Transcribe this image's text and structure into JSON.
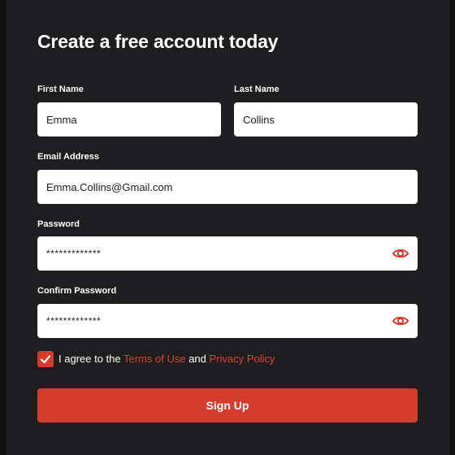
{
  "form": {
    "title": "Create a free account today",
    "first_name": {
      "label": "First Name",
      "value": "Emma"
    },
    "last_name": {
      "label": "Last Name",
      "value": "Collins"
    },
    "email": {
      "label": "Email Address",
      "value": "Emma.Collins@Gmail.com"
    },
    "password": {
      "label": "Password",
      "value": "*************"
    },
    "confirm_password": {
      "label": "Confirm Password",
      "value": "*************"
    },
    "agree": {
      "checked": true,
      "prefix": "I agree to the ",
      "terms_link": "Terms of Use",
      "joiner": " and ",
      "privacy_link": "Privacy Policy"
    },
    "submit_label": "Sign Up"
  },
  "icons": {
    "password_toggle": "eye-icon",
    "checkbox": "checkmark-icon"
  },
  "colors": {
    "background": "#1e1e20",
    "accent": "#d43d2c",
    "field": "#ffffff",
    "text": "#ffffff"
  }
}
